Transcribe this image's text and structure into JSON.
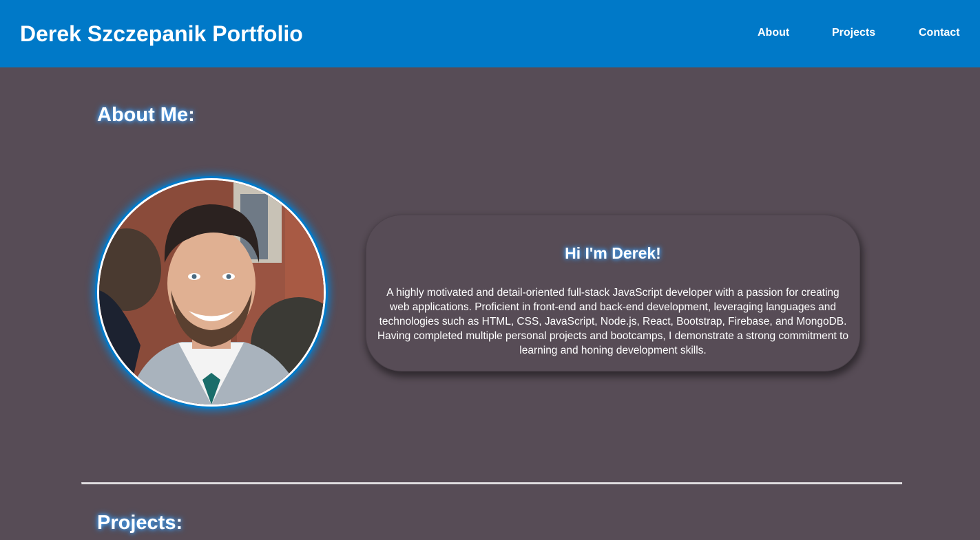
{
  "header": {
    "title": "Derek Szczepanik Portfolio",
    "nav": [
      "About",
      "Projects",
      "Contact"
    ],
    "background_color": "#0079c8"
  },
  "about": {
    "heading": "About Me:",
    "greeting": "Hi I'm Derek!",
    "bio": "A highly motivated and detail-oriented full-stack JavaScript developer with a passion for creating web applications. Proficient in front-end and back-end development, leveraging languages and technologies such as HTML, CSS, JavaScript, Node.js, React, Bootstrap, Firebase, and MongoDB. Having completed multiple personal projects and bootcamps, I demonstrate a strong commitment to learning and honing development skills."
  },
  "projects": {
    "heading": "Projects:"
  },
  "colors": {
    "page_background": "#574c56",
    "accent": "#0079c8",
    "glow": "#4aa8ff",
    "text": "#ffffff"
  }
}
